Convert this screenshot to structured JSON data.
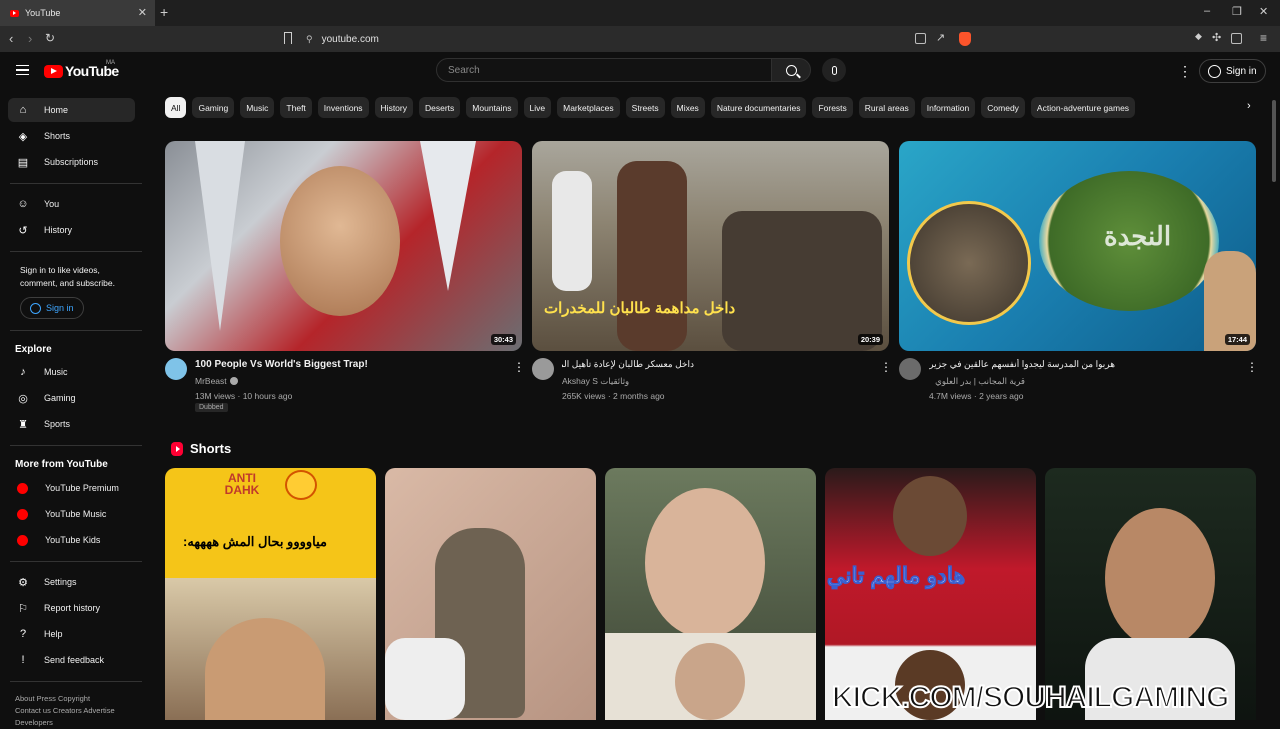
{
  "browser": {
    "tab_title": "YouTube",
    "url": "youtube.com",
    "new_tab": "+",
    "close": "✕"
  },
  "header": {
    "logo_text": "YouTube",
    "country_code": "MA",
    "search_placeholder": "Search",
    "sign_in": "Sign in"
  },
  "sidebar": {
    "main": [
      {
        "label": "Home",
        "icon": "home-icon"
      },
      {
        "label": "Shorts",
        "icon": "shorts-icon"
      },
      {
        "label": "Subscriptions",
        "icon": "subscriptions-icon"
      }
    ],
    "you": [
      {
        "label": "You",
        "icon": "you-icon"
      },
      {
        "label": "History",
        "icon": "history-icon"
      }
    ],
    "signin_message": "Sign in to like videos, comment, and subscribe.",
    "signin_button": "Sign in",
    "explore_heading": "Explore",
    "explore": [
      {
        "label": "Music",
        "icon": "music-icon"
      },
      {
        "label": "Gaming",
        "icon": "gaming-icon"
      },
      {
        "label": "Sports",
        "icon": "sports-icon"
      }
    ],
    "more_heading": "More from YouTube",
    "more": [
      {
        "label": "YouTube Premium"
      },
      {
        "label": "YouTube Music"
      },
      {
        "label": "YouTube Kids"
      }
    ],
    "settings": [
      {
        "label": "Settings",
        "icon": "settings-icon"
      },
      {
        "label": "Report history",
        "icon": "flag-icon"
      },
      {
        "label": "Help",
        "icon": "help-icon"
      },
      {
        "label": "Send feedback",
        "icon": "feedback-icon"
      }
    ],
    "footer_line1": "About  Press  Copyright",
    "footer_line2": "Contact us  Creators  Advertise",
    "footer_line3": "Developers"
  },
  "chips": [
    "All",
    "Gaming",
    "Music",
    "Theft",
    "Inventions",
    "History",
    "Deserts",
    "Mountains",
    "Live",
    "Marketplaces",
    "Streets",
    "Mixes",
    "Nature documentaries",
    "Forests",
    "Rural areas",
    "Information",
    "Comedy",
    "Action-adventure games"
  ],
  "videos": [
    {
      "title": "100 People Vs World's Biggest Trap!",
      "channel": "MrBeast",
      "meta": "13M views · 10 hours ago",
      "duration": "30:43",
      "badge": "Dubbed"
    },
    {
      "title": "داخل معسكر طالبان لإعادة تأهيل المدمنين",
      "channel": "Akshay S وثائقيات",
      "meta": "265K views · 2 months ago",
      "duration": "20:39",
      "overlay": "داخل مداهمة طالبان للمخدرات"
    },
    {
      "title": "هربوا من المدرسة ليجدوا أنفسهم عالقين في جزيرة مهجورة",
      "channel": "قرية المجانب | بدر العلوي",
      "meta": "4.7M views · 2 years ago",
      "duration": "17:44",
      "overlay": "النجدة"
    }
  ],
  "shorts": {
    "heading": "Shorts",
    "items": [
      {
        "caption": "مياوووو بحال المش ههههه:",
        "top_text": "ANTI DAHK"
      },
      {
        "caption": ""
      },
      {
        "caption": ""
      },
      {
        "caption": "هادو مالهم تاني"
      },
      {
        "caption": ""
      }
    ]
  },
  "watermark": "KICK.COM/SOUHAILGAMING"
}
